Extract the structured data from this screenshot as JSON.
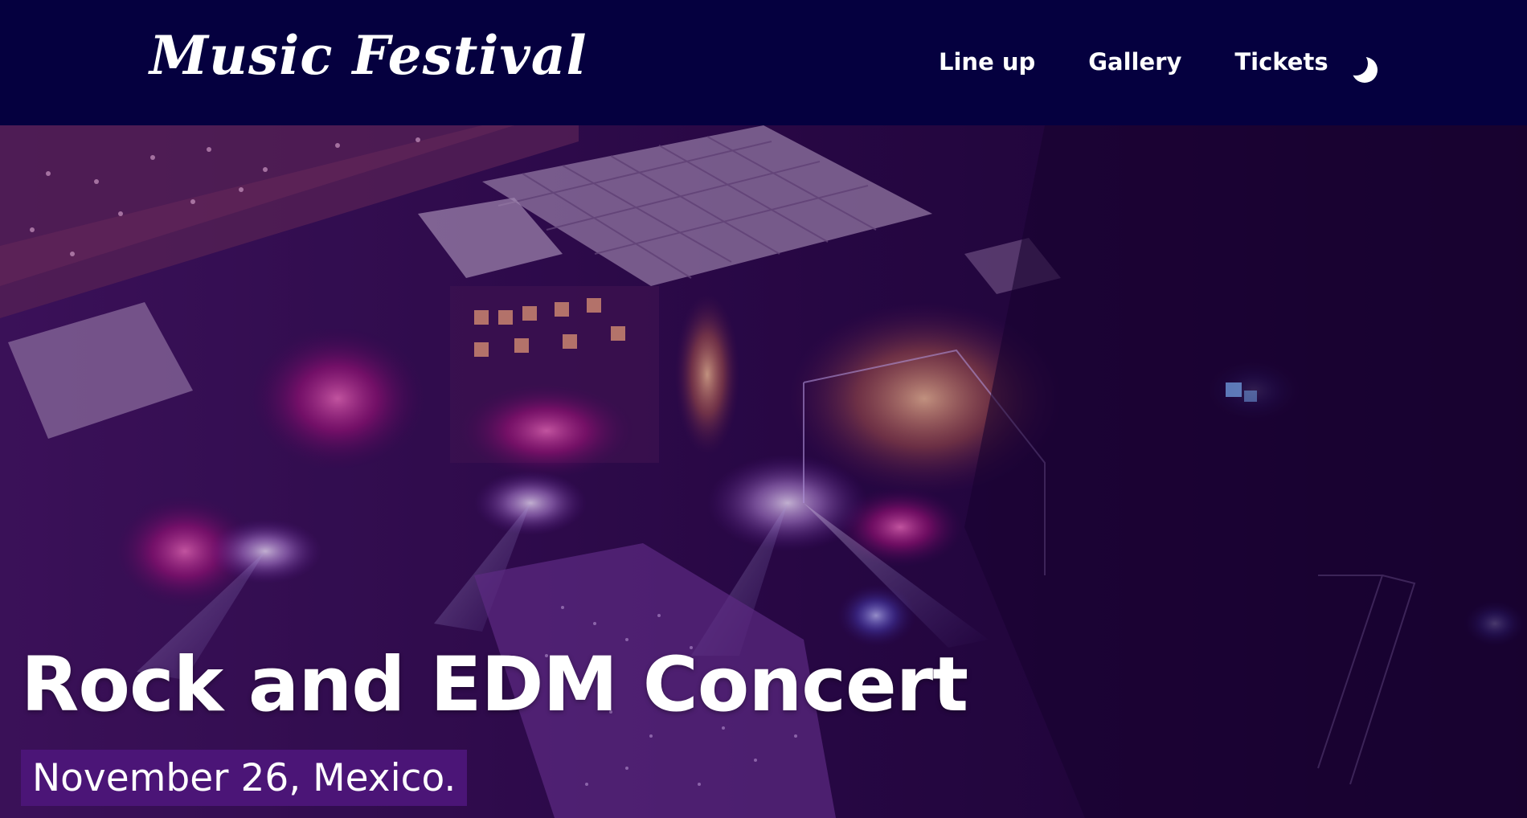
{
  "brand": {
    "name": "Music Festival"
  },
  "nav": {
    "items": [
      {
        "label": "Line up"
      },
      {
        "label": "Gallery"
      },
      {
        "label": "Tickets"
      }
    ],
    "theme_toggle_icon": "moon-icon"
  },
  "hero": {
    "title": "Rock and EDM Concert",
    "subtitle": "November 26, Mexico."
  },
  "colors": {
    "navbar_bg": "#05003f",
    "accent_purple": "#4b1577",
    "text": "#ffffff"
  }
}
